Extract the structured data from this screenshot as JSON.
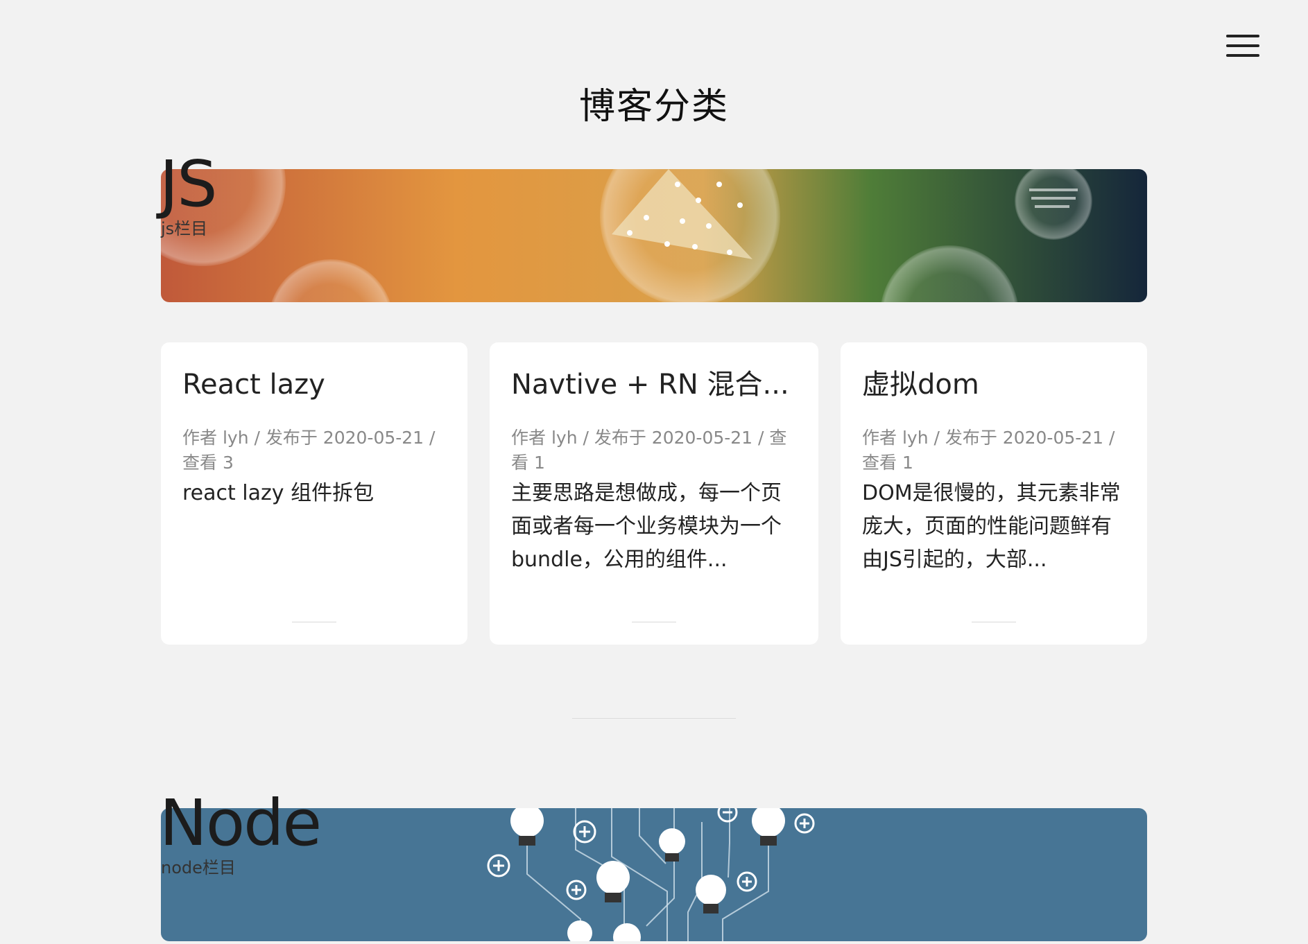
{
  "header": {
    "title": "博客分类",
    "menu_icon": "hamburger-menu-icon"
  },
  "categories": [
    {
      "name": "JS",
      "desc": "js栏目",
      "colors": {
        "banner_start": "#c0593a",
        "banner_mid": "#e3963f",
        "banner_green": "#4f7d38",
        "banner_end": "#15263a"
      },
      "posts": [
        {
          "title": "React lazy",
          "meta": "作者 lyh / 发布于 2020-05-21 / 查看 3",
          "summary": "react lazy 组件拆包"
        },
        {
          "title": "Navtive + RN 混合...",
          "meta": "作者 lyh / 发布于 2020-05-21 / 查看 1",
          "summary": "主要思路是想做成，每一个页面或者每一个业务模块为一个bundle，公用的组件..."
        },
        {
          "title": "虚拟dom",
          "meta": "作者 lyh / 发布于 2020-05-21 / 查看 1",
          "summary": "DOM是很慢的，其元素非常庞大，页面的性能问题鲜有由JS引起的，大部..."
        }
      ]
    },
    {
      "name": "Node",
      "desc": "node栏目",
      "colors": {
        "banner": "#477595"
      }
    }
  ]
}
